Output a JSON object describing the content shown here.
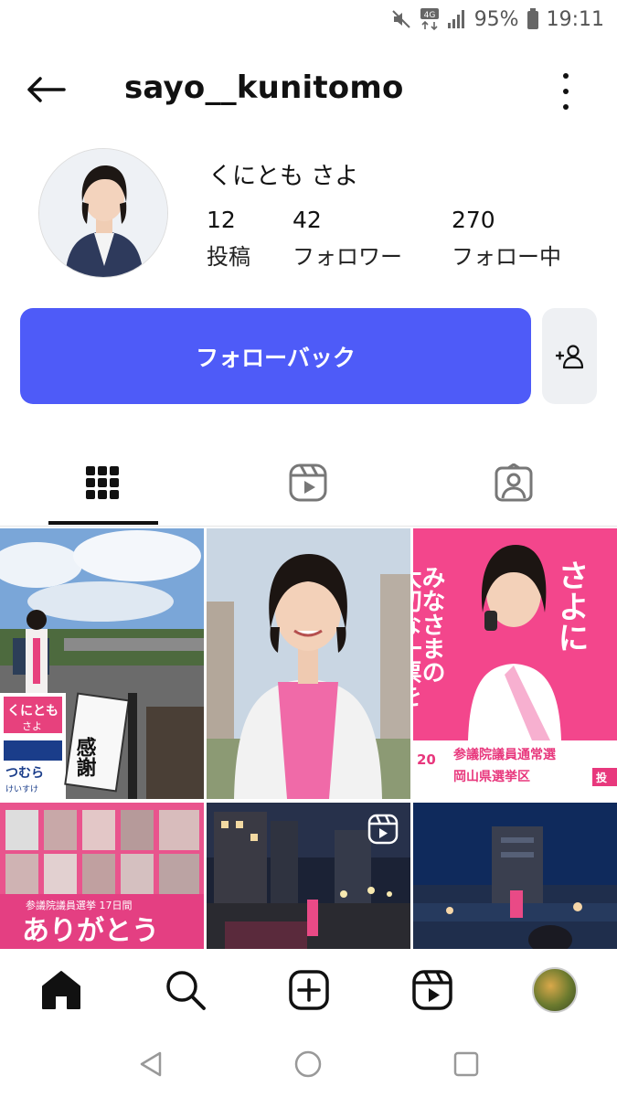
{
  "status_bar": {
    "network": "4G",
    "battery": "95%",
    "time": "19:11",
    "icons": [
      "mute-icon",
      "network-4g-icon",
      "signal-icon",
      "battery-icon"
    ]
  },
  "header": {
    "username": "sayo__kunitomo",
    "back_icon": "arrow-left-icon",
    "more_icon": "more-vertical-icon"
  },
  "profile": {
    "display_name": "くにとも さよ",
    "stats": [
      {
        "count": "12",
        "label": "投稿"
      },
      {
        "count": "42",
        "label": "フォロワー"
      },
      {
        "count": "270",
        "label": "フォロー中"
      }
    ]
  },
  "actions": {
    "follow_back_label": "フォローバック",
    "suggest_icon": "add-person-icon",
    "accent_color": "#4e5bf8"
  },
  "tabs": [
    {
      "name": "posts",
      "icon": "grid-icon",
      "active": true
    },
    {
      "name": "reels",
      "icon": "reels-icon",
      "active": false
    },
    {
      "name": "tagged",
      "icon": "tagged-person-icon",
      "active": false
    }
  ],
  "grid_posts": [
    {
      "text_1": "くにとも",
      "text_2": "さよ",
      "text_3": "つむら",
      "text_4": "けいすけ",
      "sign": "感謝"
    },
    {
      "type": "photo"
    },
    {
      "text_1": "みなさまの",
      "text_2": "大切な一票を",
      "text_3": "さよに",
      "text_4": "参議院議員通常選",
      "text_5": "岡山県選挙区",
      "text_6": "20",
      "text_7": "投"
    },
    {
      "text_1": "参議院議員選挙 17日間",
      "text_2": "ありがとう"
    },
    {
      "type": "reel",
      "icon": "reel-badge-icon"
    },
    {
      "type": "photo"
    }
  ],
  "bottom_nav": [
    "home-icon",
    "search-icon",
    "create-icon",
    "reels-icon",
    "profile-avatar"
  ]
}
